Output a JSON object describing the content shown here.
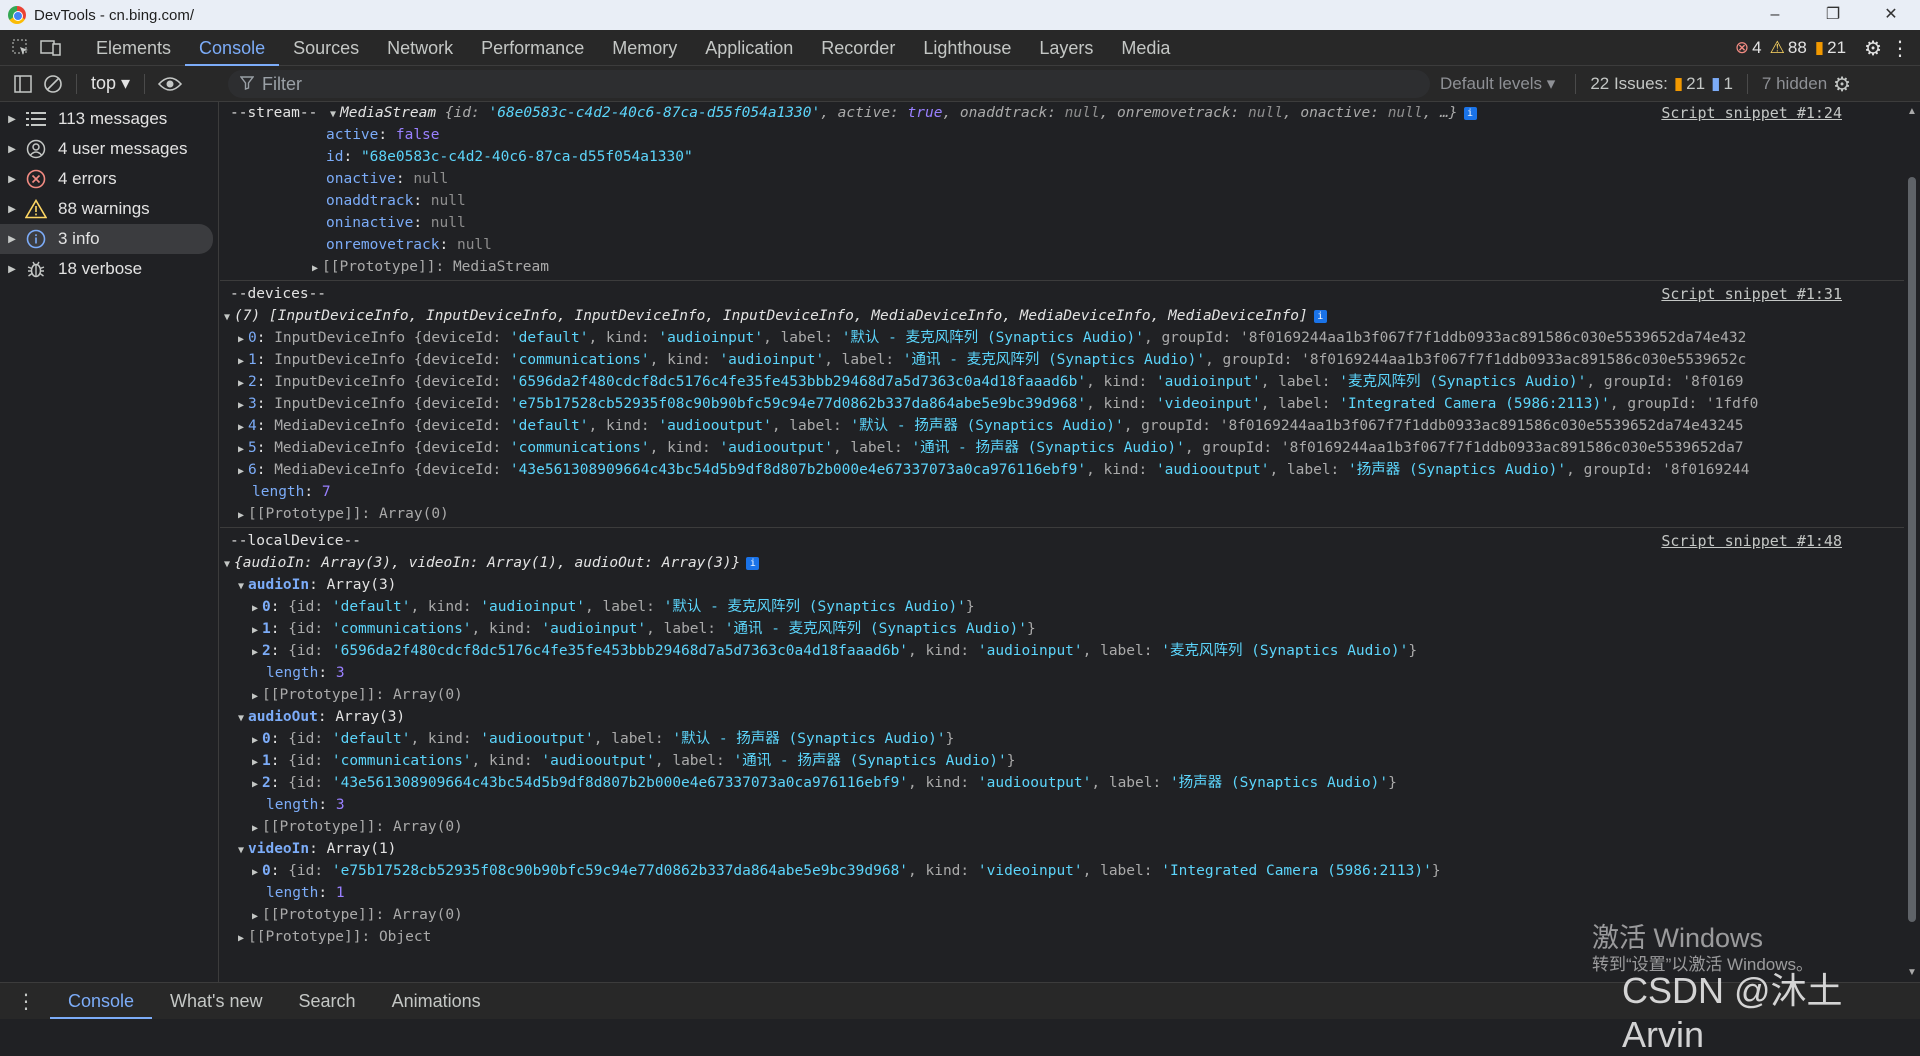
{
  "window": {
    "title": "DevTools - cn.bing.com/",
    "min": "–",
    "max": "❐",
    "close": "✕"
  },
  "tabs": [
    "Elements",
    "Console",
    "Sources",
    "Network",
    "Performance",
    "Memory",
    "Application",
    "Recorder",
    "Lighthouse",
    "Layers",
    "Media"
  ],
  "tab_counts": {
    "errors": "4",
    "warnings": "88",
    "issues": "21"
  },
  "toolbar": {
    "context": "top ▾",
    "filter_placeholder": "Filter",
    "levels": "Default levels ▾",
    "issues_label": "22 Issues:",
    "issues_warn": "21",
    "issues_info": "1",
    "hidden": "7 hidden"
  },
  "sidebar": [
    {
      "label": "113 messages",
      "icon": "list-icon"
    },
    {
      "label": "4 user messages",
      "icon": "user-icon"
    },
    {
      "label": "4 errors",
      "icon": "error-icon"
    },
    {
      "label": "88 warnings",
      "icon": "warning-icon"
    },
    {
      "label": "3 info",
      "icon": "info-icon"
    },
    {
      "label": "18 verbose",
      "icon": "bug-icon"
    }
  ],
  "stream": {
    "prefix": "--stream--",
    "source": "Script snippet #1:24",
    "summary_name": "MediaStream",
    "summary_open": "{",
    "summary_id_key": "id",
    "summary_id_val": "'68e0583c-c4d2-40c6-87ca-d55f054a1330'",
    "summary_rest_1": ", active: ",
    "summary_active": "true",
    "summary_rest_2": ", onaddtrack: ",
    "summary_null": "null",
    "summary_rest_3": ", onremovetrack: ",
    "summary_rest_4": ", onactive: ",
    "summary_rest_5": ", …}",
    "props": [
      {
        "k": "active",
        "v": "false",
        "t": "n"
      },
      {
        "k": "id",
        "v": "\"68e0583c-c4d2-40c6-87ca-d55f054a1330\"",
        "t": "s"
      },
      {
        "k": "onactive",
        "v": "null",
        "t": "null"
      },
      {
        "k": "onaddtrack",
        "v": "null",
        "t": "null"
      },
      {
        "k": "oninactive",
        "v": "null",
        "t": "null"
      },
      {
        "k": "onremovetrack",
        "v": "null",
        "t": "null"
      }
    ],
    "proto": "[[Prototype]]: MediaStream"
  },
  "devices": {
    "prefix": "--devices--",
    "source": "Script snippet #1:31",
    "summary": "(7) [InputDeviceInfo, InputDeviceInfo, InputDeviceInfo, InputDeviceInfo, MediaDeviceInfo, MediaDeviceInfo, MediaDeviceInfo]",
    "rows": [
      {
        "i": "0",
        "type": "InputDeviceInfo",
        "deviceId": "'default'",
        "kind": "'audioinput'",
        "label": "'默认 - 麦克风阵列 (Synaptics Audio)'",
        "tail": ", groupId: '8f0169244aa1b3f067f7f1ddb0933ac891586c030e5539652da74e432"
      },
      {
        "i": "1",
        "type": "InputDeviceInfo",
        "deviceId": "'communications'",
        "kind": "'audioinput'",
        "label": "'通讯 - 麦克风阵列 (Synaptics Audio)'",
        "tail": ", groupId: '8f0169244aa1b3f067f7f1ddb0933ac891586c030e5539652c"
      },
      {
        "i": "2",
        "type": "InputDeviceInfo",
        "deviceId": "'6596da2f480cdcf8dc5176c4fe35fe453bbb29468d7a5d7363c0a4d18faaad6b'",
        "kind": "'audioinput'",
        "label": "'麦克风阵列 (Synaptics Audio)'",
        "tail": ", groupId: '8f0169"
      },
      {
        "i": "3",
        "type": "InputDeviceInfo",
        "deviceId": "'e75b17528cb52935f08c90b90bfc59c94e77d0862b337da864abe5e9bc39d968'",
        "kind": "'videoinput'",
        "label": "'Integrated Camera (5986:2113)'",
        "tail": ", groupId: '1fdf0"
      },
      {
        "i": "4",
        "type": "MediaDeviceInfo",
        "deviceId": "'default'",
        "kind": "'audiooutput'",
        "label": "'默认 - 扬声器 (Synaptics Audio)'",
        "tail": ", groupId: '8f0169244aa1b3f067f7f1ddb0933ac891586c030e5539652da74e43245"
      },
      {
        "i": "5",
        "type": "MediaDeviceInfo",
        "deviceId": "'communications'",
        "kind": "'audiooutput'",
        "label": "'通讯 - 扬声器 (Synaptics Audio)'",
        "tail": ", groupId: '8f0169244aa1b3f067f7f1ddb0933ac891586c030e5539652da7"
      },
      {
        "i": "6",
        "type": "MediaDeviceInfo",
        "deviceId": "'43e561308909664c43bc54d5b9df8d807b2b000e4e67337073a0ca976116ebf9'",
        "kind": "'audiooutput'",
        "label": "'扬声器 (Synaptics Audio)'",
        "tail": ", groupId: '8f0169244"
      }
    ],
    "length_key": "length",
    "length_val": "7",
    "proto": "[[Prototype]]: Array(0)"
  },
  "local": {
    "prefix": "--localDevice--",
    "source": "Script snippet #1:48",
    "summary": "{audioIn: Array(3), videoIn: Array(1), audioOut: Array(3)}",
    "groups": [
      {
        "name": "audioIn",
        "type": "Array(3)",
        "items": [
          {
            "i": "0",
            "id": "'default'",
            "kind": "'audioinput'",
            "label": "'默认 - 麦克风阵列 (Synaptics Audio)'"
          },
          {
            "i": "1",
            "id": "'communications'",
            "kind": "'audioinput'",
            "label": "'通讯 - 麦克风阵列 (Synaptics Audio)'"
          },
          {
            "i": "2",
            "id": "'6596da2f480cdcf8dc5176c4fe35fe453bbb29468d7a5d7363c0a4d18faaad6b'",
            "kind": "'audioinput'",
            "label": "'麦克风阵列 (Synaptics Audio)'"
          }
        ],
        "length": "3"
      },
      {
        "name": "audioOut",
        "type": "Array(3)",
        "items": [
          {
            "i": "0",
            "id": "'default'",
            "kind": "'audiooutput'",
            "label": "'默认 - 扬声器 (Synaptics Audio)'"
          },
          {
            "i": "1",
            "id": "'communications'",
            "kind": "'audiooutput'",
            "label": "'通讯 - 扬声器 (Synaptics Audio)'"
          },
          {
            "i": "2",
            "id": "'43e561308909664c43bc54d5b9df8d807b2b000e4e67337073a0ca976116ebf9'",
            "kind": "'audiooutput'",
            "label": "'扬声器 (Synaptics Audio)'"
          }
        ],
        "length": "3"
      },
      {
        "name": "videoIn",
        "type": "Array(1)",
        "items": [
          {
            "i": "0",
            "id": "'e75b17528cb52935f08c90b90bfc59c94e77d0862b337da864abe5e9bc39d968'",
            "kind": "'videoinput'",
            "label": "'Integrated Camera (5986:2113)'"
          }
        ],
        "length": "1"
      }
    ],
    "array_proto": "[[Prototype]]: Array(0)",
    "obj_proto": "[[Prototype]]: Object"
  },
  "drawer_tabs": [
    "Console",
    "What's new",
    "Search",
    "Animations"
  ],
  "overlay": {
    "activate": "激活 Windows",
    "activate_sub": "转到“设置”以激活 Windows。",
    "csdn": "CSDN @沐土Arvin"
  }
}
